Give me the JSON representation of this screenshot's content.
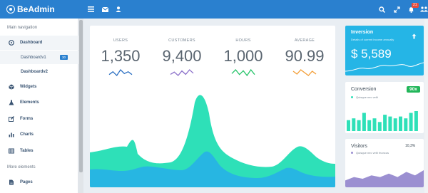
{
  "brand": {
    "name": "BeAdmin"
  },
  "topbar": {
    "icons": [
      "menu-icon",
      "mail-icon",
      "user-icon",
      "search-icon",
      "expand-icon",
      "bell-icon",
      "users-icon"
    ],
    "notification_count": "21"
  },
  "sidebar": {
    "heading_main": "Main navigation",
    "heading_more": "More elements",
    "items": [
      {
        "label": "Dashboard",
        "icon": "gauge-icon"
      },
      {
        "label": "Dashboardv1",
        "badge": "30"
      },
      {
        "label": "Dashboardv2"
      },
      {
        "label": "Widgets",
        "icon": "cube-icon"
      },
      {
        "label": "Elements",
        "icon": "flask-icon"
      },
      {
        "label": "Forms",
        "icon": "edit-icon"
      },
      {
        "label": "Charts",
        "icon": "bar-chart-icon"
      },
      {
        "label": "Tables",
        "icon": "table-icon"
      },
      {
        "label": "Pages",
        "icon": "file-icon"
      }
    ]
  },
  "stats": [
    {
      "label": "USERS",
      "value": "1,350",
      "color": "#2b6fc2"
    },
    {
      "label": "CUSTOMERS",
      "value": "9,400",
      "color": "#8a6fc9"
    },
    {
      "label": "HOURS",
      "value": "1,000",
      "color": "#27c46a"
    },
    {
      "label": "AVERAGE",
      "value": "90.99",
      "color": "#f39c33"
    }
  ],
  "colors": {
    "accent": "#2a80cf",
    "area_green": "#2ee0b8",
    "area_blue": "#27b6e2",
    "inversion_bg": "#25b5e6",
    "conversion_bar": "#2ee0b8",
    "conversion_badge": "#22b65a",
    "visitors_area": "#9b8fd1"
  },
  "inversion": {
    "title": "Inversion",
    "subtitle": "Details of current income annually",
    "value": "$ 5,589"
  },
  "conversion": {
    "title": "Conversion",
    "badge": "90x",
    "legend": "Quisque nec velit"
  },
  "visitors": {
    "title": "Visitors",
    "percent": "10,3%",
    "legend": "Quisque nec velit rhoncus"
  },
  "sparklines": [
    [
      3,
      6,
      2,
      8,
      4,
      6,
      3
    ],
    [
      3,
      5,
      2,
      6,
      3,
      7,
      4
    ],
    [
      4,
      8,
      3,
      7,
      2,
      8,
      3
    ],
    [
      5,
      3,
      6,
      4,
      2,
      5,
      3
    ]
  ],
  "conversion_bars": [
    6,
    7,
    6,
    10,
    6,
    7,
    5,
    9,
    8,
    7,
    8,
    7,
    10,
    11
  ],
  "visitors_series": [
    4,
    6,
    5,
    7,
    6,
    8,
    6,
    9,
    7,
    10
  ]
}
